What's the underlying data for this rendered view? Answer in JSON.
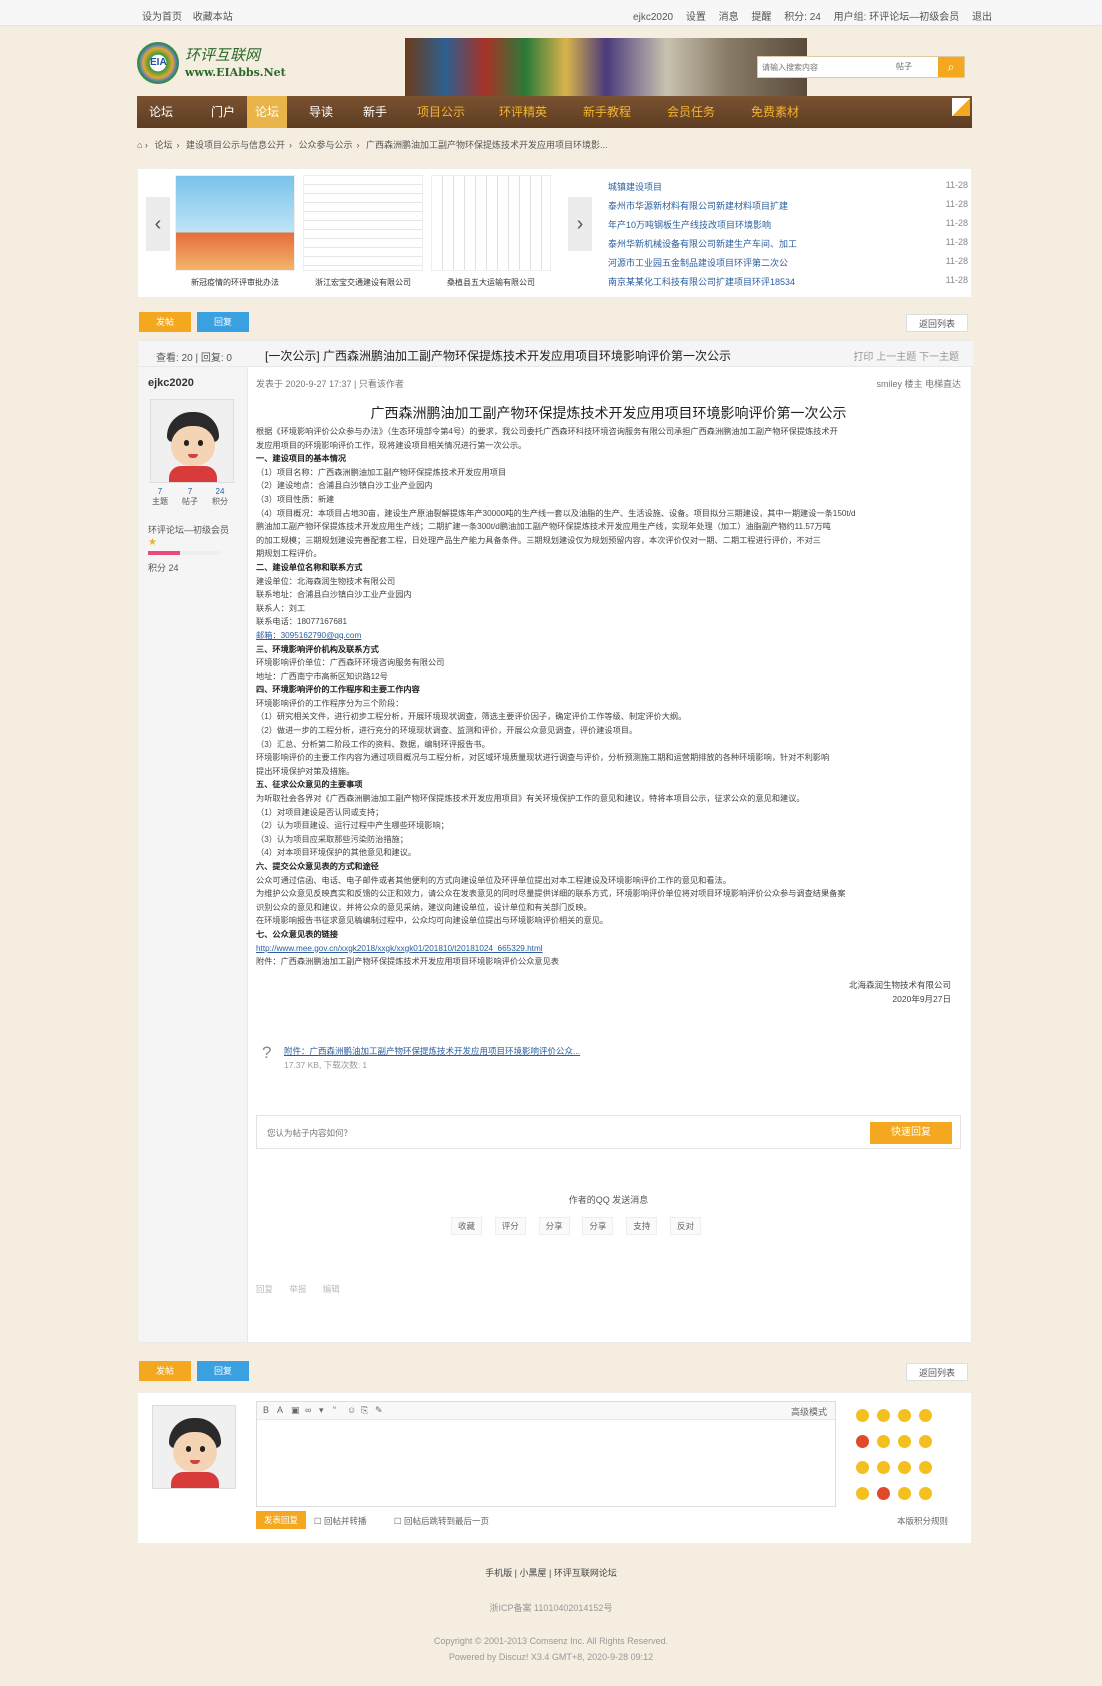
{
  "topbar": {
    "left": [
      "设为首页",
      "收藏本站"
    ],
    "right": [
      "ejkc2020",
      "设置",
      "消息",
      "提醒",
      "积分: 24",
      "用户组: 环评论坛—初级会员",
      "退出"
    ]
  },
  "logo": {
    "name": "环评互联网",
    "url": "www.EIAbbs.Net",
    "badge": "EIA"
  },
  "search": {
    "placeholder": "请输入搜索内容",
    "scope": "帖子",
    "icon": "search-icon"
  },
  "nav": {
    "items": [
      "论坛",
      "门户",
      "论坛",
      "导读",
      "新手",
      "项目公示",
      "环评精英",
      "新手教程",
      "会员任务",
      "免费素材"
    ],
    "active_index": 2
  },
  "breadcrumb": [
    "论坛",
    "建设项目公示与信息公开",
    "公众参与公示",
    "广西森洲鹏油加工副产物环保提炼技术开发应用项目环境影..."
  ],
  "slider": {
    "captions": [
      "新冠疫情的环评审批办法",
      "浙江宏宝交通建设有限公司",
      "桑植县五大运输有限公司"
    ],
    "news": [
      {
        "title": "城镇建设项目",
        "date": "11-28"
      },
      {
        "title": "泰州市华源新材料有限公司新建材料项目扩建",
        "date": "11-28"
      },
      {
        "title": "年产10万吨钢板生产线技改项目环境影响",
        "date": "11-28"
      },
      {
        "title": "泰州华新机械设备有限公司新建生产车间、加工",
        "date": "11-28"
      },
      {
        "title": "河源市工业园五金制品建设项目环评第二次公",
        "date": "11-28"
      },
      {
        "title": "南京某某化工科技有限公司扩建项目环评18534",
        "date": "11-28"
      }
    ]
  },
  "post_buttons": {
    "post": "发帖",
    "reply": "回复",
    "back": "返回列表"
  },
  "thread": {
    "views_label": "查看: 20 | 回复: 0",
    "title": "[一次公示] 广西森洲鹏油加工副产物环保提炼技术开发应用项目环境影响评价第一次公示",
    "tools": "打印 上一主题 下一主题"
  },
  "author": {
    "name": "ejkc2020",
    "stats": [
      {
        "v": "7",
        "l": "主题"
      },
      {
        "v": "7",
        "l": "帖子"
      },
      {
        "v": "24",
        "l": "积分"
      }
    ],
    "group": "环评论坛—初级会员",
    "stars": "★",
    "progress": 0.45,
    "points": "积分 24"
  },
  "post": {
    "meta": "发表于 2020-9-27 17:37 | 只看该作者",
    "meta_right": "smiley 楼主 电梯直达",
    "title": "广西森洲鹏油加工副产物环保提炼技术开发应用项目环境影响评价第一次公示",
    "paragraphs": [
      {
        "t": "根据《环境影响评价公众参与办法》（生态环境部令第4号）的要求，我公司委托广西森环科技环境咨询服务有限公司承担广西森洲鹏油加工副产物环保提炼技术开",
        "h": false
      },
      {
        "t": "发应用项目的环境影响评价工作，现将建设项目相关情况进行第一次公示。",
        "h": false
      },
      {
        "t": "一、建设项目的基本情况",
        "h": true
      },
      {
        "t": "（1）项目名称：广西森洲鹏油加工副产物环保提炼技术开发应用项目",
        "h": false
      },
      {
        "t": "（2）建设地点：合浦县白沙镇白沙工业产业园内",
        "h": false
      },
      {
        "t": "（3）项目性质：新建",
        "h": false
      },
      {
        "t": "（4）项目概况：本项目占地30亩，建设生产原油裂解提炼年产30000吨的生产线一套以及油脂的生产、生活设施、设备。项目拟分三期建设，其中一期建设一条150t/d",
        "h": false
      },
      {
        "t": "鹏油加工副产物环保提炼技术开发应用生产线；二期扩建一条300t/d鹏油加工副产物环保提炼技术开发应用生产线，实现年处理（加工）油脂副产物约11.57万吨",
        "h": false
      },
      {
        "t": "的加工规模；三期规划建设完善配套工程，日处理产品生产能力具备条件。三期规划建设仅为规划预留内容，本次评价仅对一期、二期工程进行评价，不对三",
        "h": false
      },
      {
        "t": "期规划工程评价。",
        "h": false
      },
      {
        "t": "二、建设单位名称和联系方式",
        "h": true
      },
      {
        "t": "建设单位：北海森润生物技术有限公司",
        "h": false
      },
      {
        "t": "联系地址：合浦县白沙镇白沙工业产业园内",
        "h": false
      },
      {
        "t": "联系人：刘工",
        "h": false
      },
      {
        "t": "联系电话：18077167681",
        "h": false
      },
      {
        "t": "邮箱：3095162790@qq.com",
        "h": false,
        "link": true
      },
      {
        "t": "三、环境影响评价机构及联系方式",
        "h": true
      },
      {
        "t": "环境影响评价单位：广西森环环境咨询服务有限公司",
        "h": false
      },
      {
        "t": "地址：广西南宁市高新区知识路12号",
        "h": false
      },
      {
        "t": "四、环境影响评价的工作程序和主要工作内容",
        "h": true
      },
      {
        "t": "环境影响评价的工作程序分为三个阶段：",
        "h": false
      },
      {
        "t": "（1）研究相关文件，进行初步工程分析，开展环境现状调查，筛选主要评价因子，确定评价工作等级、制定评价大纲。",
        "h": false
      },
      {
        "t": "（2）做进一步的工程分析，进行充分的环境现状调查、监测和评价，开展公众意见调查，评价建设项目。",
        "h": false
      },
      {
        "t": "（3）汇总、分析第二阶段工作的资料、数据，编制环评报告书。",
        "h": false
      },
      {
        "t": "环境影响评价的主要工作内容为通过项目概况与工程分析，对区域环境质量现状进行调查与评价，分析预测施工期和运营期排放的各种环境影响，针对不利影响",
        "h": false
      },
      {
        "t": "提出环境保护对策及措施。",
        "h": false
      },
      {
        "t": "五、征求公众意见的主要事项",
        "h": true
      },
      {
        "t": "为听取社会各界对《广西森洲鹏油加工副产物环保提炼技术开发应用项目》有关环境保护工作的意见和建议，特将本项目公示，征求公众的意见和建议。",
        "h": false
      },
      {
        "t": "（1）对项目建设是否认同或支持；",
        "h": false
      },
      {
        "t": "（2）认为项目建设、运行过程中产生哪些环境影响；",
        "h": false
      },
      {
        "t": "（3）认为项目应采取那些污染防治措施；",
        "h": false
      },
      {
        "t": "（4）对本项目环境保护的其他意见和建议。",
        "h": false
      },
      {
        "t": "六、提交公众意见表的方式和途径",
        "h": true
      },
      {
        "t": "公众可通过信函、电话、电子邮件或者其他便利的方式向建设单位及环评单位提出对本工程建设及环境影响评价工作的意见和看法。",
        "h": false
      },
      {
        "t": "为维护公众意见反映真实和反馈的公正和效力，请公众在发表意见的同时尽量提供详细的联系方式，环境影响评价单位将对项目环境影响评价公众参与调查结果备案",
        "h": false
      },
      {
        "t": "识别公众的意见和建议，并将公众的意见采纳，建议向建设单位，设计单位和有关部门反映。",
        "h": false
      },
      {
        "t": "在环境影响报告书征求意见稿编制过程中，公众均可向建设单位提出与环境影响评价相关的意见。",
        "h": false
      },
      {
        "t": "七、公众意见表的链接",
        "h": true
      },
      {
        "t": "http://www.mee.gov.cn/xxgk2018/xxgk/xxgk01/201810/t20181024_665329.html",
        "h": false,
        "link": true
      },
      {
        "t": "附件：广西森洲鹏油加工副产物环保提炼技术开发应用项目环境影响评价公众意见表",
        "h": false
      }
    ],
    "sign_company": "北海森润生物技术有限公司",
    "sign_date": "2020年9月27日",
    "attachment_link": "附件：广西森洲鹏油加工副产物环保提炼技术开发应用项目环境影响评价公众...",
    "attachment_info": "17.37 KB, 下载次数: 1",
    "reply_placeholder": "您认为帖子内容如何？",
    "reply_button": "快速回复",
    "author_line": "作者的QQ 发送消息",
    "actions": [
      "收藏",
      "评分",
      "分享",
      "分享",
      "支持",
      "反对"
    ],
    "bottom_tools": [
      "回复",
      "举报",
      "编辑"
    ]
  },
  "editor": {
    "toolbar_label": "高级模式",
    "submit": "发表回复",
    "options": [
      "回帖并转播",
      "回帖后跳转到最后一页"
    ],
    "right_hint": "本版积分规则"
  },
  "footer": {
    "links": "手机版 | 小黑屋 | 环评互联网论坛",
    "icp": "浙ICP备案 11010402014152号",
    "copyright": "Copyright © 2001-2013 Comsenz Inc.  All Rights Reserved.",
    "powered": "Powered by Discuz! X3.4  GMT+8, 2020-9-28 09:12"
  },
  "colors": {
    "accent": "#f3a81f",
    "blue_button": "#3aa0e0",
    "nav": "#6b4628",
    "link": "#2a5ea0"
  }
}
